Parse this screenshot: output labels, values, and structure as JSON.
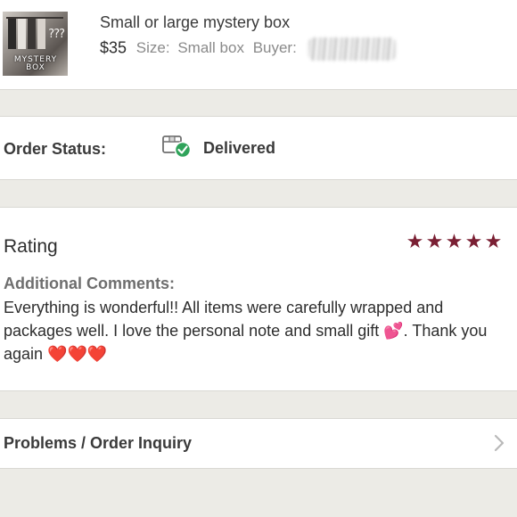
{
  "item": {
    "title": "Small or large mystery box",
    "price": "$35",
    "size_label": "Size:",
    "size_value": "Small box",
    "buyer_label": "Buyer:",
    "thumbnail_text": "MYSTERY BOX",
    "thumbnail_marks": "???"
  },
  "order_status": {
    "label": "Order Status:",
    "value": "Delivered",
    "icon": "package-delivered-icon",
    "check_color": "#2fa35a"
  },
  "rating": {
    "label": "Rating",
    "stars": 5,
    "max_stars": 5,
    "star_color": "#7a1f33",
    "comments_label": "Additional Comments:",
    "comments_text": "Everything is wonderful!! All items were carefully wrapped and packages well. I love the personal note and small gift 💕. Thank you again ❤️❤️❤️"
  },
  "problems": {
    "label": "Problems / Order Inquiry",
    "icon": "chevron-right-icon"
  }
}
